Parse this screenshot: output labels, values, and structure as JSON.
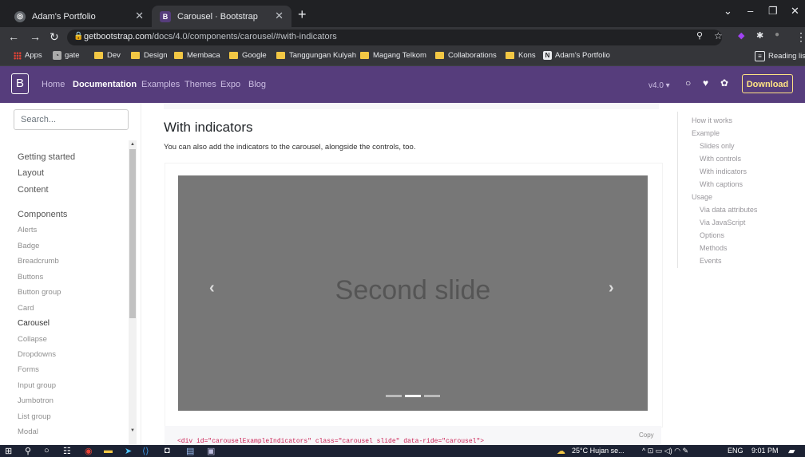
{
  "browser": {
    "tabs": [
      {
        "title": "Adam's Portfolio",
        "active": false
      },
      {
        "title": "Carousel · Bootstrap",
        "active": true
      }
    ],
    "url_host": "getbootstrap.com",
    "url_path": "/docs/4.0/components/carousel/#with-indicators",
    "bookmarks": [
      "Apps",
      "gate",
      "Dev",
      "Design",
      "Membaca",
      "Google",
      "Tanggungan Kulyah",
      "Magang Telkom",
      "Collaborations",
      "Kons",
      "Adam's Portfolio"
    ],
    "reading_list": "Reading list"
  },
  "navbar": {
    "brand": "B",
    "links": [
      "Home",
      "Documentation",
      "Examples",
      "Themes",
      "Expo",
      "Blog"
    ],
    "version": "v4.0 ▾",
    "download": "Download"
  },
  "sidebar": {
    "search_placeholder": "Search...",
    "groups": [
      "Getting started",
      "Layout",
      "Content",
      "Components"
    ],
    "items": [
      "Alerts",
      "Badge",
      "Breadcrumb",
      "Buttons",
      "Button group",
      "Card",
      "Carousel",
      "Collapse",
      "Dropdowns",
      "Forms",
      "Input group",
      "Jumbotron",
      "List group",
      "Modal"
    ]
  },
  "main": {
    "heading": "With indicators",
    "description": "You can also add the indicators to the carousel, alongside the controls, too.",
    "slide_text": "Second slide",
    "prev": "‹",
    "next": "›",
    "copy": "Copy",
    "code": "<div id=\"carouselExampleIndicators\" class=\"carousel slide\" data-ride=\"carousel\">"
  },
  "toc": {
    "items": [
      "How it works",
      "Example",
      "Slides only",
      "With controls",
      "With indicators",
      "With captions",
      "Usage",
      "Via data attributes",
      "Via JavaScript",
      "Options",
      "Methods",
      "Events"
    ]
  },
  "taskbar": {
    "weather": "25°C  Hujan se...",
    "lang": "ENG",
    "time": "9:01 PM"
  },
  "colors": {
    "navbar": "#563d7c",
    "download": "#ffe484"
  }
}
